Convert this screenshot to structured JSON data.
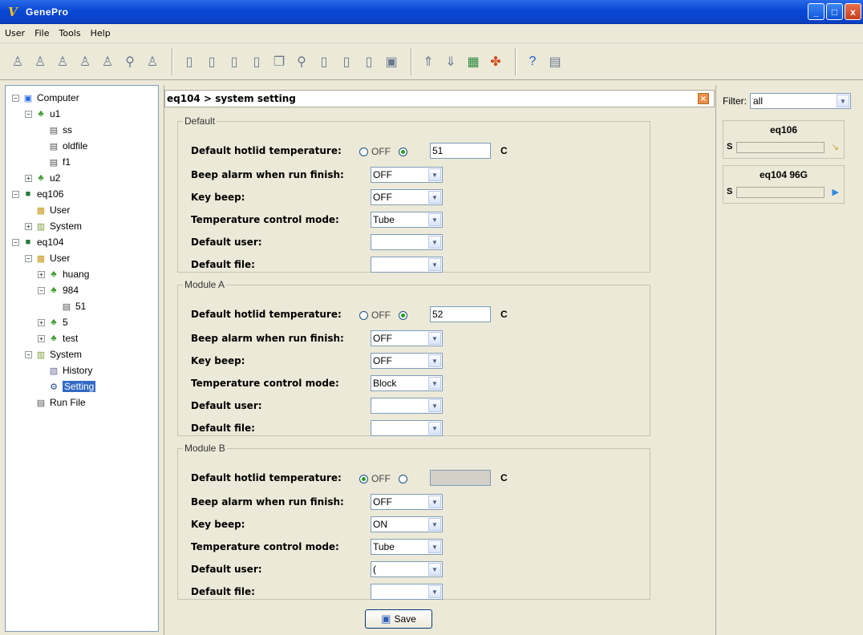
{
  "window": {
    "title": "GenePro",
    "min": "_",
    "max": "□",
    "close": "x"
  },
  "menu": [
    "User",
    "File",
    "Tools",
    "Help"
  ],
  "toolbar": {
    "icons": [
      "user-icon",
      "users-icon",
      "add-user-icon",
      "edit-user-icon",
      "group-icon",
      "search-user-icon",
      "delete-user-icon",
      "new-file-icon",
      "open-file-icon",
      "file-icon",
      "edit-file-icon",
      "copy-file-icon",
      "find-file-icon",
      "import-file-icon",
      "export-file-icon",
      "file-props-icon",
      "save-file-icon",
      "upload-icon",
      "download-icon",
      "monitor-icon",
      "network-icon",
      "help-icon",
      "info-icon"
    ]
  },
  "tree": [
    {
      "label": "Computer",
      "level": 0,
      "exp": "−",
      "icon": "computer-icon"
    },
    {
      "label": "u1",
      "level": 1,
      "exp": "−",
      "icon": "user-icon"
    },
    {
      "label": "ss",
      "level": 2,
      "exp": "",
      "icon": "file-icon"
    },
    {
      "label": "oldfile",
      "level": 2,
      "exp": "",
      "icon": "file-icon"
    },
    {
      "label": "f1",
      "level": 2,
      "exp": "",
      "icon": "file-icon"
    },
    {
      "label": "u2",
      "level": 1,
      "exp": "+",
      "icon": "user-icon"
    },
    {
      "label": "eq106",
      "level": 0,
      "exp": "−",
      "icon": "device-icon"
    },
    {
      "label": "User",
      "level": 1,
      "exp": "",
      "icon": "user-folder-icon"
    },
    {
      "label": "System",
      "level": 1,
      "exp": "+",
      "icon": "system-icon"
    },
    {
      "label": "eq104",
      "level": 0,
      "exp": "−",
      "icon": "device-icon"
    },
    {
      "label": "User",
      "level": 1,
      "exp": "−",
      "icon": "user-folder-icon"
    },
    {
      "label": "huang",
      "level": 2,
      "exp": "+",
      "icon": "user-icon"
    },
    {
      "label": "984",
      "level": 2,
      "exp": "−",
      "icon": "user-icon"
    },
    {
      "label": "51",
      "level": 3,
      "exp": "",
      "icon": "file-icon"
    },
    {
      "label": "5",
      "level": 2,
      "exp": "+",
      "icon": "user-icon"
    },
    {
      "label": "test",
      "level": 2,
      "exp": "+",
      "icon": "user-icon"
    },
    {
      "label": "System",
      "level": 1,
      "exp": "−",
      "icon": "system-icon"
    },
    {
      "label": "History",
      "level": 2,
      "exp": "",
      "icon": "history-icon"
    },
    {
      "label": "Setting",
      "level": 2,
      "exp": "",
      "icon": "setting-icon",
      "selected": true
    },
    {
      "label": "Run File",
      "level": 1,
      "exp": "",
      "icon": "run-file-icon"
    }
  ],
  "main": {
    "header": "eq104 > system setting",
    "groups": [
      {
        "title": "Default",
        "hotlid_off": false,
        "hotlid_value": "51",
        "beep": "OFF",
        "keybeep": "OFF",
        "mode": "Tube",
        "user": "",
        "file": ""
      },
      {
        "title": "Module A",
        "hotlid_off": false,
        "hotlid_value": "52",
        "beep": "OFF",
        "keybeep": "OFF",
        "mode": "Block",
        "user": "",
        "file": ""
      },
      {
        "title": "Module B",
        "hotlid_off": true,
        "hotlid_value": "",
        "beep": "OFF",
        "keybeep": "ON",
        "mode": "Tube",
        "user": "(",
        "file": ""
      }
    ],
    "labels": {
      "hotlid": "Default hotlid temperature:",
      "off": "OFF",
      "unit": "C",
      "beep": "Beep alarm when run finish:",
      "keybeep": "Key beep:",
      "mode": "Temperature control mode:",
      "user": "Default user:",
      "file": "Default file:"
    },
    "save": "Save"
  },
  "right": {
    "filter_label": "Filter:",
    "filter_value": "all",
    "devices": [
      {
        "name": "eq106",
        "s": "S",
        "indicator": "↘"
      },
      {
        "name": "eq104 96G",
        "s": "S",
        "indicator": "▶"
      }
    ]
  },
  "colors": {
    "titlebar": "#0a49d6",
    "selection": "#316ac5",
    "panel": "#ece9d8"
  }
}
